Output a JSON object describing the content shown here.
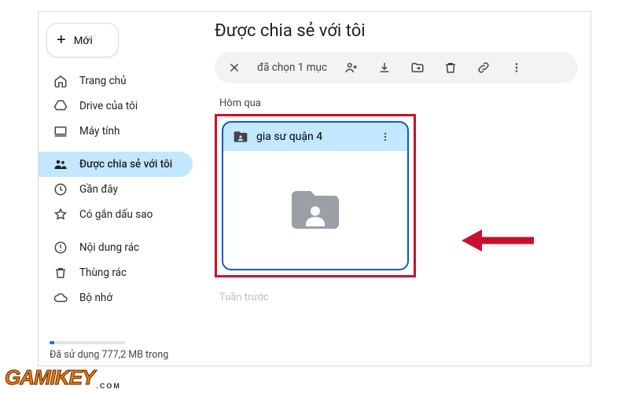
{
  "sidebar": {
    "new_label": "Mới",
    "items": [
      {
        "label": "Trang chủ"
      },
      {
        "label": "Drive của tôi"
      },
      {
        "label": "Máy tính"
      },
      {
        "label": "Được chia sẻ với tôi"
      },
      {
        "label": "Gần đây"
      },
      {
        "label": "Có gắn dấu sao"
      },
      {
        "label": "Nội dung rác"
      },
      {
        "label": "Thùng rác"
      },
      {
        "label": "Bộ nhớ"
      }
    ],
    "storage_text": "Đã sử dụng 777,2 MB trong"
  },
  "main": {
    "title": "Được chia sẻ với tôi",
    "selection_text": "đã chọn 1 mục",
    "section_yesterday": "Hôm qua",
    "section_lastweek": "Tuần trước",
    "folder_name": "gia sư quận 4"
  },
  "watermark": {
    "brand": "GAMIKEY",
    "suffix": ".COM"
  }
}
